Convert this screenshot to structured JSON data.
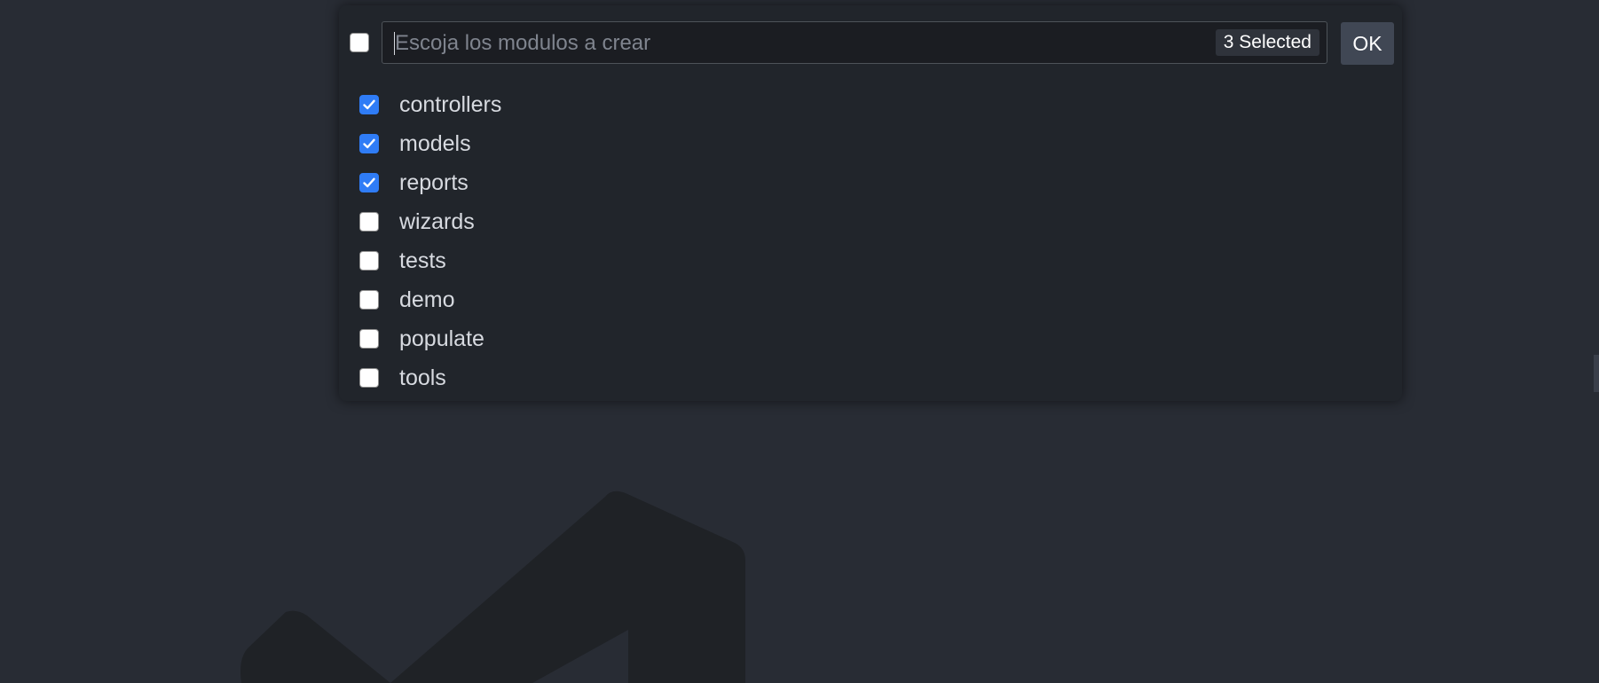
{
  "quick_pick": {
    "filter_placeholder": "Escoja los modulos a crear",
    "filter_value": "",
    "selected_badge": "3 Selected",
    "ok_label": "OK",
    "select_all_checked": false,
    "options": [
      {
        "label": "controllers",
        "checked": true
      },
      {
        "label": "models",
        "checked": true
      },
      {
        "label": "reports",
        "checked": true
      },
      {
        "label": "wizards",
        "checked": false
      },
      {
        "label": "tests",
        "checked": false
      },
      {
        "label": "demo",
        "checked": false
      },
      {
        "label": "populate",
        "checked": false
      },
      {
        "label": "tools",
        "checked": false
      }
    ]
  },
  "colors": {
    "editor_background": "#282c34",
    "widget_background": "#21252b",
    "checkbox_checked": "#2f7cf6",
    "ok_button": "#404754",
    "watermark": "#1f2226"
  },
  "icons": {
    "watermark": "vscode-logo-icon",
    "check": "check-icon"
  }
}
